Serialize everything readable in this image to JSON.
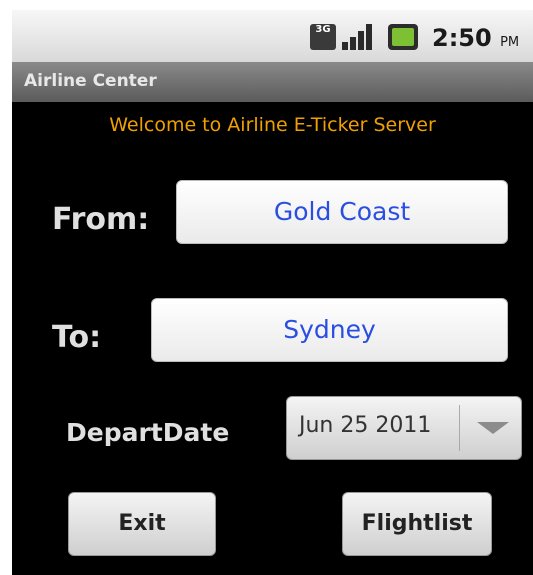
{
  "status_bar": {
    "network_badge": "3G",
    "icons": [
      "3g-icon",
      "signal-icon",
      "battery-icon"
    ],
    "time": "2:50",
    "ampm": "PM"
  },
  "app": {
    "title": "Airline Center",
    "welcome": "Welcome to Airline E-Ticker Server"
  },
  "form": {
    "from_label": "From:",
    "from_value": "Gold Coast",
    "to_label": "To:",
    "to_value": "Sydney",
    "date_label": "DepartDate",
    "date_value": "Jun 25 2011"
  },
  "buttons": {
    "exit": "Exit",
    "flightlist": "Flightlist"
  },
  "colors": {
    "welcome_text": "#f0a000",
    "field_text": "#2a4ee0",
    "background": "#000000"
  }
}
